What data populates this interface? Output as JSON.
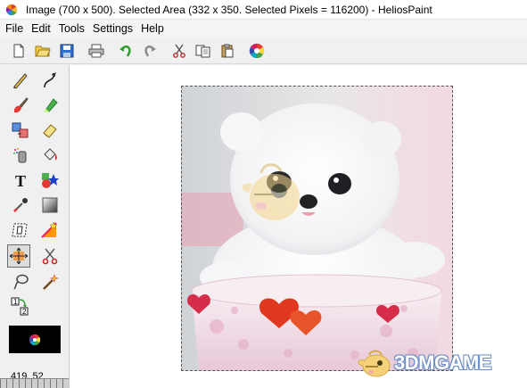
{
  "window": {
    "title": "Image (700 x 500).    Selected Area (332 x 350.  Selected Pixels = 116200)  - HeliosPaint"
  },
  "menu": [
    "File",
    "Edit",
    "Tools",
    "Settings",
    "Help"
  ],
  "toolbar": {
    "buttons": [
      "new-icon",
      "open-icon",
      "save-icon",
      "print-icon",
      "undo-icon",
      "redo-icon",
      "cut-icon",
      "copy-icon",
      "paste-icon",
      "color-wheel-icon"
    ]
  },
  "tools": [
    "pencil-icon",
    "curve-icon",
    "brush-icon",
    "highlighter-icon",
    "clone-icon",
    "eraser-icon",
    "spray-icon",
    "fill-bucket-icon",
    "text-icon",
    "shapes-icon",
    "eyedropper-icon",
    "gradient-icon",
    "transform-icon",
    "color-replace-icon",
    "move-selection-icon",
    "scissors-icon",
    "lasso-icon",
    "magic-wand-icon",
    "swap-colors-icon"
  ],
  "status": {
    "coordinates": "419, 52"
  },
  "watermark": {
    "text": "3DMGAME"
  }
}
